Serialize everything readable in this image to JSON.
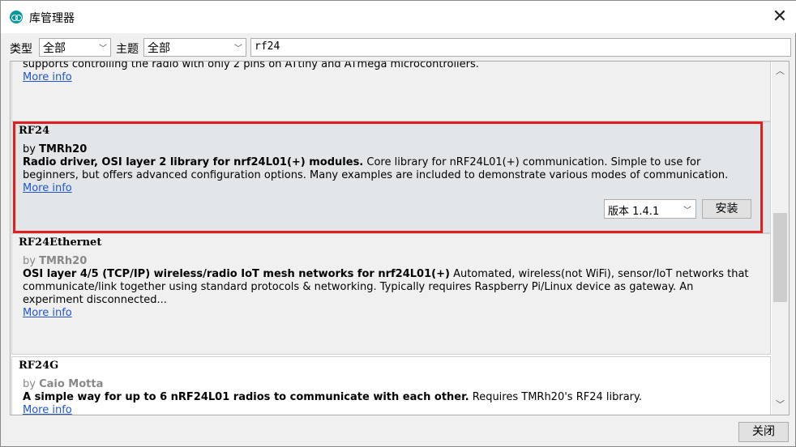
{
  "window": {
    "title": "库管理器"
  },
  "filters": {
    "type_label": "类型",
    "type_value": "全部",
    "topic_label": "主题",
    "topic_value": "全部",
    "search_value": "rf24"
  },
  "libraries": [
    {
      "desc": "supports controlling the radio with only 2 pins on ATtiny and ATmega microcontrollers.",
      "more": "More info"
    },
    {
      "name": "RF24",
      "by": "by ",
      "author": "TMRh20",
      "summary": "Radio driver, OSI layer 2 library for nrf24L01(+) modules.",
      "desc": " Core library for nRF24L01(+) communication. Simple to use for beginners, but offers advanced configuration options. Many examples are included to demonstrate various modes of communication.",
      "more": "More info",
      "version": "版本 1.4.1",
      "install": "安装"
    },
    {
      "name": "RF24Ethernet",
      "by": "by ",
      "author": "TMRh20",
      "summary": "OSI layer 4/5 (TCP/IP) wireless/radio IoT mesh networks for nrf24L01(+)",
      "desc": " Automated, wireless(not WiFi), sensor/IoT networks that communicate/link together using standard protocols & networking. Typically requires Raspberry Pi/Linux device as gateway. An experiment disconnected...",
      "more": "More info"
    },
    {
      "name": "RF24G",
      "by": "by ",
      "author": "Caio Motta",
      "summary": "A simple way for up to 6 nRF24L01 radios to communicate with each other.",
      "desc": " Requires TMRh20's RF24 library.",
      "more": "More info"
    }
  ],
  "footer": {
    "close": "关闭"
  },
  "colors": {
    "highlight": "#e02020",
    "link": "#2255cc"
  }
}
